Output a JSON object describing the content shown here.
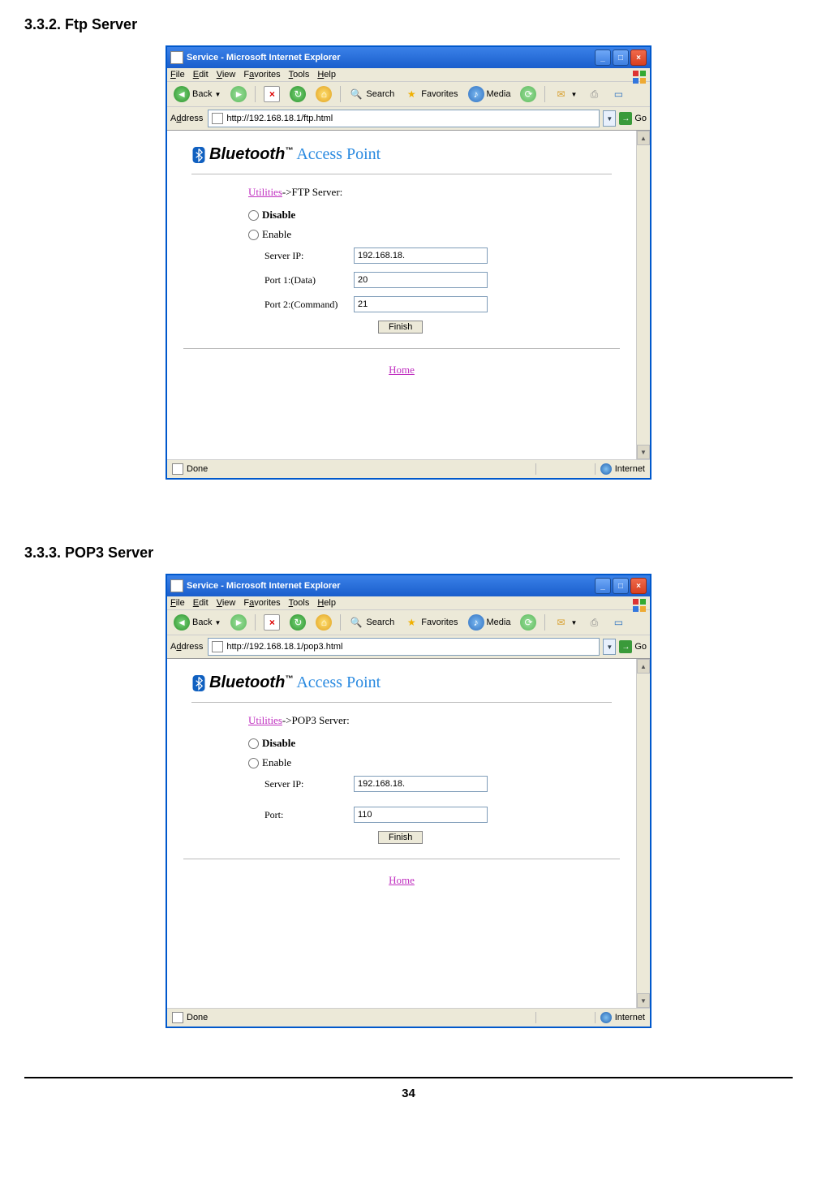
{
  "sections": {
    "ftp": {
      "heading": "3.3.2. Ftp Server"
    },
    "pop3": {
      "heading": "3.3.3. POP3 Server"
    }
  },
  "browser": {
    "title": "Service - Microsoft Internet Explorer",
    "menus": {
      "file": "File",
      "edit": "Edit",
      "view": "View",
      "favorites": "Favorites",
      "tools": "Tools",
      "help": "Help"
    },
    "toolbar": {
      "back": "Back",
      "search": "Search",
      "favorites": "Favorites",
      "media": "Media"
    },
    "address_label": "Address",
    "go": "Go",
    "status_done": "Done",
    "status_zone": "Internet"
  },
  "logo": {
    "bluetooth": "Bluetooth",
    "tm": "™",
    "access_point": "Access Point"
  },
  "ftp_page": {
    "url": "http://192.168.18.1/ftp.html",
    "bc_link": "Utilities",
    "bc_rest": "->FTP Server:",
    "disable": "Disable",
    "enable": "Enable",
    "server_ip_label": "Server IP:",
    "server_ip_value": "192.168.18.",
    "port1_label": "Port 1:(Data)",
    "port1_value": "20",
    "port2_label": "Port 2:(Command)",
    "port2_value": "21",
    "finish": "Finish",
    "home": "Home"
  },
  "pop3_page": {
    "url": "http://192.168.18.1/pop3.html",
    "bc_link": "Utilities",
    "bc_rest": "->POP3 Server:",
    "disable": "Disable",
    "enable": "Enable",
    "server_ip_label": "Server IP:",
    "server_ip_value": "192.168.18.",
    "port_label": "Port:",
    "port_value": "110",
    "finish": "Finish",
    "home": "Home"
  },
  "page_number": "34"
}
